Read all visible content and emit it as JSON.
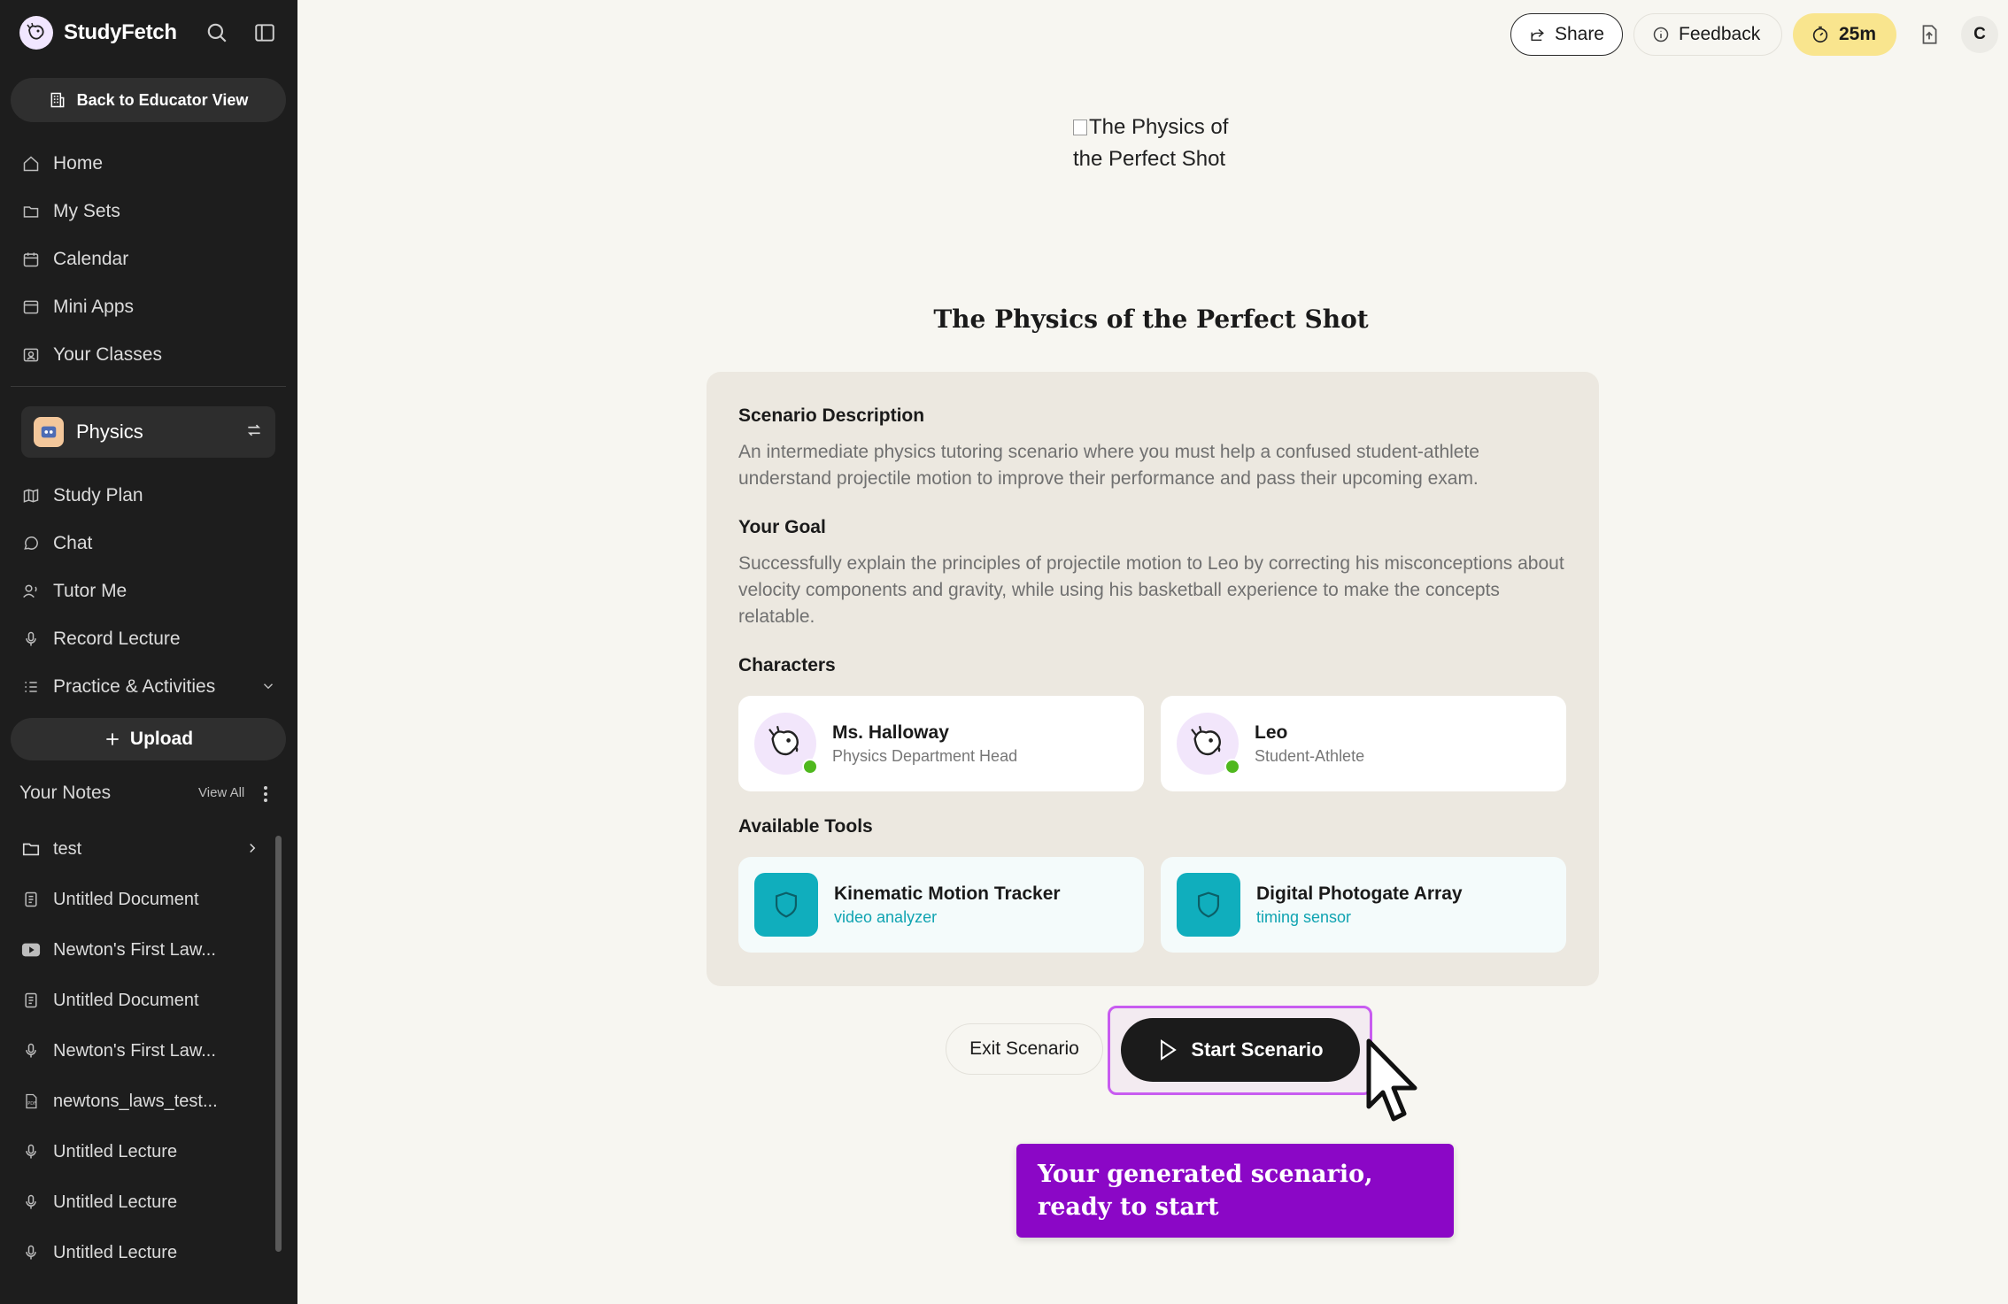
{
  "brand": {
    "name": "StudyFetch"
  },
  "sidebar": {
    "educator_button": "Back to Educator View",
    "nav": [
      {
        "label": "Home",
        "icon": "home-icon"
      },
      {
        "label": "My Sets",
        "icon": "folder-icon"
      },
      {
        "label": "Calendar",
        "icon": "calendar-icon"
      },
      {
        "label": "Mini Apps",
        "icon": "window-icon"
      },
      {
        "label": "Your Classes",
        "icon": "classes-icon"
      }
    ],
    "current_class": "Physics",
    "class_nav": [
      {
        "label": "Study Plan",
        "icon": "map-icon"
      },
      {
        "label": "Chat",
        "icon": "chat-icon"
      },
      {
        "label": "Tutor Me",
        "icon": "tutor-icon"
      },
      {
        "label": "Record Lecture",
        "icon": "mic-icon"
      },
      {
        "label": "Practice & Activities",
        "icon": "list-icon"
      }
    ],
    "upload_label": "Upload",
    "notes_title": "Your Notes",
    "notes_view_all": "View All",
    "notes": [
      {
        "label": "test",
        "icon": "folder-icon"
      },
      {
        "label": "Untitled Document",
        "icon": "document-icon"
      },
      {
        "label": "Newton's First Law...",
        "icon": "youtube-icon"
      },
      {
        "label": "Untitled Document",
        "icon": "document-icon"
      },
      {
        "label": "Newton's First Law...",
        "icon": "mic-icon"
      },
      {
        "label": "newtons_laws_test...",
        "icon": "pdf-icon"
      },
      {
        "label": "Untitled Lecture",
        "icon": "mic-icon"
      },
      {
        "label": "Untitled Lecture",
        "icon": "mic-icon"
      },
      {
        "label": "Untitled Lecture",
        "icon": "mic-icon"
      }
    ]
  },
  "topbar": {
    "share": "Share",
    "feedback": "Feedback",
    "timer": "25m",
    "avatar_initial": "C"
  },
  "scenario": {
    "image_alt": "The Physics of the Perfect Shot",
    "title": "The Physics of the Perfect Shot",
    "description_heading": "Scenario Description",
    "description": "An intermediate physics tutoring scenario where you must help a confused student-athlete understand projectile motion to improve their performance and pass their upcoming exam.",
    "goal_heading": "Your Goal",
    "goal": "Successfully explain the principles of projectile motion to Leo by correcting his misconceptions about velocity components and gravity, while using his basketball experience to make the concepts relatable.",
    "characters_heading": "Characters",
    "characters": [
      {
        "name": "Ms. Halloway",
        "role": "Physics Department Head"
      },
      {
        "name": "Leo",
        "role": "Student-Athlete"
      }
    ],
    "tools_heading": "Available Tools",
    "tools": [
      {
        "name": "Kinematic Motion Tracker",
        "type": "video analyzer"
      },
      {
        "name": "Digital Photogate Array",
        "type": "timing sensor"
      }
    ],
    "exit_label": "Exit Scenario",
    "start_label": "Start Scenario"
  },
  "callout": {
    "text": "Your generated scenario, ready to start"
  },
  "colors": {
    "accent_purple": "#8b07c6",
    "highlight": "#c85cf0",
    "tool_teal": "#10aebd",
    "timer_yellow": "#f9e58e",
    "online_green": "#4fb81e"
  }
}
